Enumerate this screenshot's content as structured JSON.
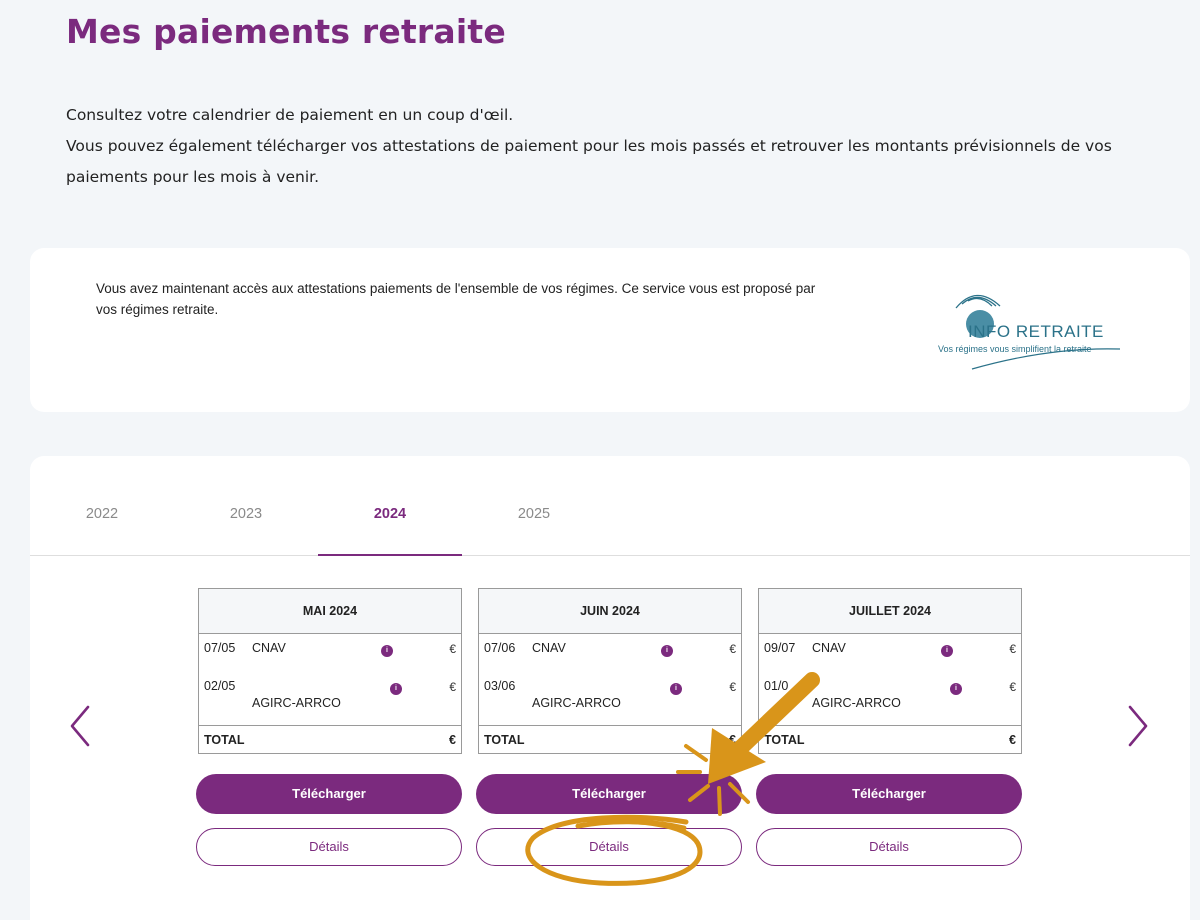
{
  "page": {
    "title": "Mes paiements retraite",
    "intro_line1": "Consultez votre calendrier de paiement en un coup d'œil.",
    "intro_line2": "Vous pouvez également télécharger vos attestations de paiement pour les mois passés et retrouver les montants prévisionnels de vos paiements pour les mois à venir."
  },
  "info_banner": {
    "text": "Vous avez maintenant accès aux attestations paiements de l'ensemble de vos régimes. Ce service vous est proposé par vos régimes retraite.",
    "logo_title": "INFO RETRAITE",
    "logo_subtitle": "Vos régimes vous simplifient la retraite"
  },
  "tabs": [
    {
      "label": "2022",
      "active": false
    },
    {
      "label": "2023",
      "active": false
    },
    {
      "label": "2024",
      "active": true
    },
    {
      "label": "2025",
      "active": false
    }
  ],
  "months": [
    {
      "title": "MAI 2024",
      "rows": [
        {
          "date": "07/05",
          "org": "CNAV",
          "org2": "",
          "currency": "€"
        },
        {
          "date": "02/05",
          "org": "",
          "org2": "AGIRC-ARRCO",
          "currency": "€"
        }
      ],
      "total_label": "TOTAL",
      "total_currency": "€",
      "download_label": "Télécharger",
      "details_label": "Détails"
    },
    {
      "title": "JUIN 2024",
      "rows": [
        {
          "date": "07/06",
          "org": "CNAV",
          "org2": "",
          "currency": "€"
        },
        {
          "date": "03/06",
          "org": "",
          "org2": "AGIRC-ARRCO",
          "currency": "€"
        }
      ],
      "total_label": "TOTAL",
      "total_currency": "€",
      "download_label": "Télécharger",
      "details_label": "Détails"
    },
    {
      "title": "JUILLET 2024",
      "rows": [
        {
          "date": "09/07",
          "org": "CNAV",
          "org2": "",
          "currency": "€"
        },
        {
          "date": "01/0",
          "org": "",
          "org2": "AGIRC-ARRCO",
          "currency": "€"
        }
      ],
      "total_label": "TOTAL",
      "total_currency": "€",
      "download_label": "Télécharger",
      "details_label": "Détails"
    }
  ],
  "colors": {
    "brand": "#7b2a7e",
    "annotation": "#d9951a",
    "logo": "#2b7289"
  },
  "icons": {
    "prev": "chevron-left-icon",
    "next": "chevron-right-icon",
    "info": "info-dot-icon"
  }
}
